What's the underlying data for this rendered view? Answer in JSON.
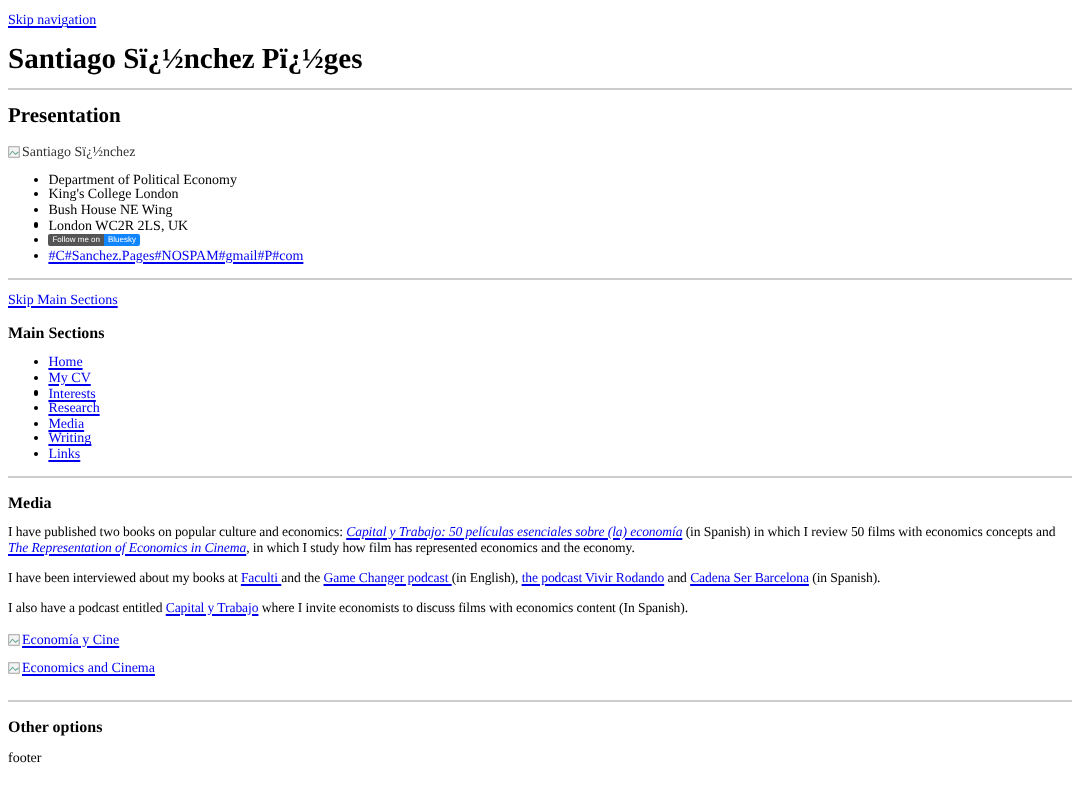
{
  "skip_navigation": "Skip navigation",
  "title": "Santiago Sï¿½nchez Pï¿½ges",
  "presentation": {
    "heading": "Presentation",
    "photo_alt": "Santiago Sï¿½nchez",
    "address": [
      "Department of Political Economy",
      "King's College London",
      "Bush House NE Wing",
      "London WC2R 2LS, UK"
    ],
    "bluesky_badge": {
      "label": "Follow me on",
      "service": "Bluesky"
    },
    "email": "#C#Sanchez.Pages#NOSPAM#gmail#P#com"
  },
  "skip_main": "Skip Main Sections",
  "main_sections": {
    "heading": "Main Sections",
    "links": [
      "Home",
      "My CV",
      "Interests",
      "Research",
      "Media",
      "Writing",
      "Links"
    ]
  },
  "media": {
    "heading": "Media",
    "paragraphs": [
      [
        {
          "text": "I have published two books on popular culture and economics: "
        },
        {
          "text": "Capital y Trabajo: 50 películas esenciales sobre (la) economía",
          "link": true,
          "italic": true
        },
        {
          "text": " (in Spanish) in which I review 50 films with economics concepts and "
        },
        {
          "text": "The Representation of Economics in Cinema",
          "link": true,
          "italic": true
        },
        {
          "text": ", in which I study how film has represented economics and the economy."
        }
      ],
      [
        {
          "text": "I have been interviewed about my books at "
        },
        {
          "text": "Faculti ",
          "link": true
        },
        {
          "text": "and the "
        },
        {
          "text": "Game Changer podcast ",
          "link": true
        },
        {
          "text": "(in English), "
        },
        {
          "text": "the podcast Vivir Rodando",
          "link": true
        },
        {
          "text": " and "
        },
        {
          "text": "Cadena Ser Barcelona",
          "link": true
        },
        {
          "text": " (in Spanish)."
        }
      ],
      [
        {
          "text": "I also have a podcast entitled "
        },
        {
          "text": "Capital y Trabajo",
          "link": true
        },
        {
          "text": " where I invite economists to discuss films with economics content (In Spanish)."
        }
      ]
    ],
    "image_links": [
      "Economía y Cine",
      "Economics and Cinema"
    ]
  },
  "other_options": {
    "heading": "Other options",
    "footer": "footer"
  }
}
